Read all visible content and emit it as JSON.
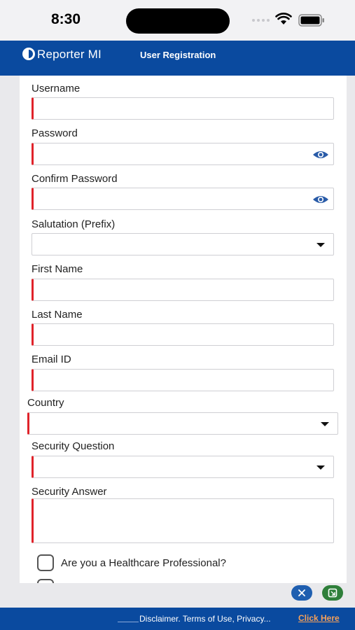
{
  "status_bar": {
    "time": "8:30",
    "icons": [
      "signal-dots-icon",
      "wifi-icon",
      "battery-icon"
    ]
  },
  "header": {
    "logo_icon": "reporter-logo-icon",
    "app_title": "Reporter MI",
    "page_title": "User Registration",
    "background_color": "#0a4a9f"
  },
  "form": {
    "required_marker_color": "#e0232a",
    "fields": [
      {
        "label": "Username",
        "value": "",
        "type": "text",
        "required": true
      },
      {
        "label": "Password",
        "value": "",
        "type": "password",
        "required": true,
        "icon": "eye-icon"
      },
      {
        "label": "Confirm Password",
        "value": "",
        "type": "password",
        "required": true,
        "icon": "eye-icon"
      },
      {
        "label": "Salutation (Prefix)",
        "value": "",
        "type": "select",
        "required": false
      },
      {
        "label": "First Name",
        "value": "",
        "type": "text",
        "required": true
      },
      {
        "label": "Last Name",
        "value": "",
        "type": "text",
        "required": true
      },
      {
        "label": "Email ID",
        "value": "",
        "type": "text",
        "required": true
      },
      {
        "label": "Country",
        "value": "",
        "type": "select",
        "required": true
      },
      {
        "label": "Security Question",
        "value": "",
        "type": "select",
        "required": true
      },
      {
        "label": "Security Answer",
        "value": "",
        "type": "textarea",
        "required": true
      }
    ],
    "checkboxes": [
      {
        "label": "Are you a Healthcare Professional?",
        "checked": false
      }
    ]
  },
  "floating_buttons": {
    "close_icon": "close-icon",
    "app_icon": "app-switch-icon"
  },
  "footer": {
    "text": "Disclaimer. Terms of Use, Privacy...",
    "link_label": "Click Here",
    "link_color": "#f5a05a"
  }
}
